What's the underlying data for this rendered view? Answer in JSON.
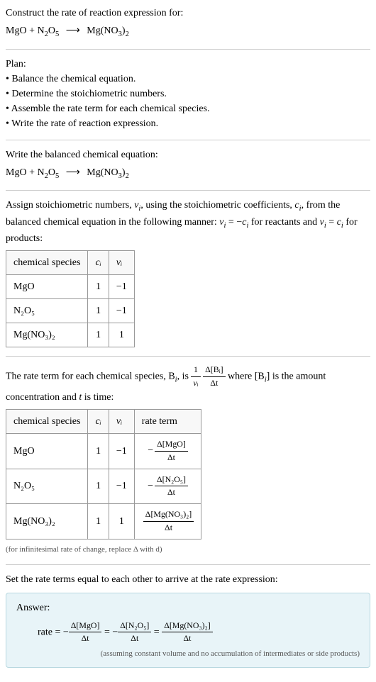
{
  "header": {
    "construct_text": "Construct the rate of reaction expression for:",
    "reactant1": "MgO",
    "plus": " + ",
    "reactant2_base": "N",
    "reactant2_sub1": "2",
    "reactant2_mid": "O",
    "reactant2_sub2": "5",
    "arrow": "⟶",
    "product_base": "Mg(NO",
    "product_sub1": "3",
    "product_mid": ")",
    "product_sub2": "2"
  },
  "plan": {
    "title": "Plan:",
    "items": [
      "• Balance the chemical equation.",
      "• Determine the stoichiometric numbers.",
      "• Assemble the rate term for each chemical species.",
      "• Write the rate of reaction expression."
    ]
  },
  "balanced": {
    "title": "Write the balanced chemical equation:"
  },
  "stoich": {
    "text1": "Assign stoichiometric numbers, ",
    "nu_i": "ν",
    "nu_sub": "i",
    "text2": ", using the stoichiometric coefficients, ",
    "c_i": "c",
    "c_sub": "i",
    "text3": ", from the balanced chemical equation in the following manner: ",
    "eq1_lhs": "ν",
    "eq1_lhs_sub": "i",
    "eq1_eq": " = −",
    "eq1_rhs": "c",
    "eq1_rhs_sub": "i",
    "text4": " for reactants and ",
    "eq2_lhs": "ν",
    "eq2_lhs_sub": "i",
    "eq2_eq": " = ",
    "eq2_rhs": "c",
    "eq2_rhs_sub": "i",
    "text5": " for products:",
    "table": {
      "headers": [
        "chemical species",
        "cᵢ",
        "νᵢ"
      ],
      "rows": [
        {
          "species": "MgO",
          "c": "1",
          "nu": "−1"
        },
        {
          "species": "N₂O₅",
          "c": "1",
          "nu": "−1"
        },
        {
          "species": "Mg(NO₃)₂",
          "c": "1",
          "nu": "1"
        }
      ]
    }
  },
  "rateterm": {
    "text1": "The rate term for each chemical species, B",
    "sub_i": "i",
    "text2": ", is ",
    "frac1_num": "1",
    "frac1_den": "νᵢ",
    "frac2_num": "Δ[Bᵢ]",
    "frac2_den": "Δt",
    "text3": " where [B",
    "text4": "] is the amount concentration and ",
    "t_var": "t",
    "text5": " is time:",
    "table": {
      "headers": [
        "chemical species",
        "cᵢ",
        "νᵢ",
        "rate term"
      ],
      "rows": [
        {
          "species": "MgO",
          "c": "1",
          "nu": "−1",
          "rate_num": "Δ[MgO]",
          "rate_den": "Δt",
          "neg": "−"
        },
        {
          "species": "N₂O₅",
          "c": "1",
          "nu": "−1",
          "rate_num": "Δ[N₂O₅]",
          "rate_den": "Δt",
          "neg": "−"
        },
        {
          "species": "Mg(NO₃)₂",
          "c": "1",
          "nu": "1",
          "rate_num": "Δ[Mg(NO₃)₂]",
          "rate_den": "Δt",
          "neg": ""
        }
      ]
    },
    "note": "(for infinitesimal rate of change, replace Δ with d)"
  },
  "final": {
    "title": "Set the rate terms equal to each other to arrive at the rate expression:"
  },
  "answer": {
    "label": "Answer:",
    "rate_label": "rate = ",
    "neg": "−",
    "eq": " = ",
    "t1_num": "Δ[MgO]",
    "t1_den": "Δt",
    "t2_num": "Δ[N₂O₅]",
    "t2_den": "Δt",
    "t3_num": "Δ[Mg(NO₃)₂]",
    "t3_den": "Δt",
    "note": "(assuming constant volume and no accumulation of intermediates or side products)"
  }
}
